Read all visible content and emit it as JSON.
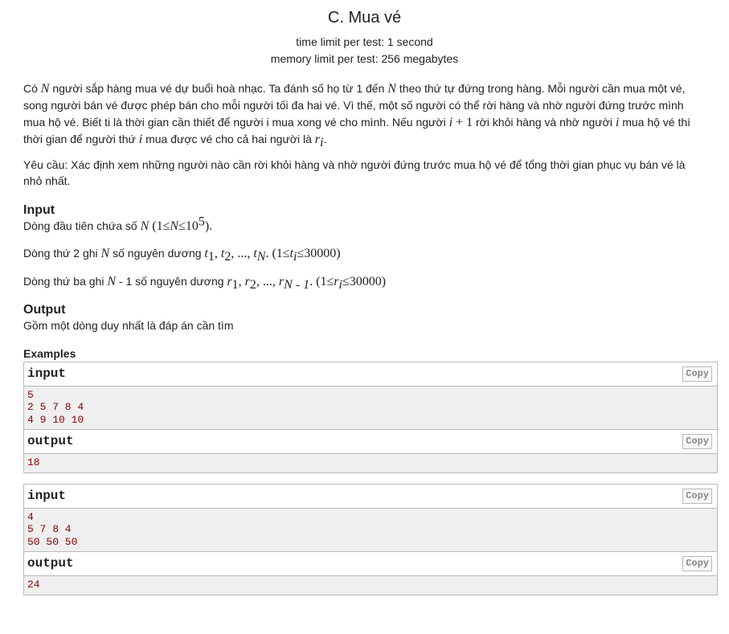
{
  "header": {
    "title": "C. Mua vé",
    "time_limit": "time limit per test: 1 second",
    "memory_limit": "memory limit per test: 256 megabytes"
  },
  "statement": {
    "p1": {
      "a": "Có ",
      "n": "N",
      "b": " người sắp hàng mua vé dự buổi hoà nhạc. Ta đánh số họ từ 1 đến ",
      "n2": "N",
      "c": " theo thứ tự đứng trong hàng. Mỗi người cần mua một vé, song người bán vé được phép bán cho mỗi người tối đa hai vé. Vì thế, một số người có thể rời hàng và nhờ người đứng trước mình mua hộ vé. Biết ti là thời gian cần thiết để người i mua xong vé cho mình. Nếu người ",
      "i1": "i",
      "plus": " + 1",
      "d": " rời khỏi hàng và nhờ người ",
      "i2": "i",
      "e": " mua hộ vé thì thời gian để người thứ ",
      "i3": "i",
      "f": " mua được vé cho cả hai người là ",
      "r": "r",
      "rsub": "i",
      "dot": "."
    },
    "p2": "Yêu cầu: Xác định xem những người nào cần rời khỏi hàng và nhờ người đứng trước mua hộ vé để tổng thời gian phục vụ bán vé là nhỏ nhất."
  },
  "input_section": {
    "title": "Input",
    "line1": {
      "a": "Dòng đầu tiên chứa số ",
      "n": "N",
      "open": " (1≤",
      "n2": "N",
      "le": "≤10",
      "exp": "5",
      "close": ")."
    },
    "line2": {
      "a": "Dòng thứ 2 ghi ",
      "n": "N",
      "b": " số nguyên dương ",
      "t": "t",
      "s1": "1",
      "c1": ", ",
      "t2": "t",
      "s2": "2",
      "c2": ", ..., ",
      "t3": "t",
      "sN": "N",
      "d": ". (1≤",
      "t4": "t",
      "si": "i",
      "e": "≤30000)"
    },
    "line3": {
      "a": "Dòng thứ ba ghi ",
      "n": "N",
      "b": " - 1 số nguyên dương ",
      "r": "r",
      "s1": "1",
      "c1": ", ",
      "r2": "r",
      "s2": "2",
      "c2": ", ..., ",
      "r3": "r",
      "sN": "N - 1",
      "d": ". (1≤",
      "r4": "r",
      "si": "i",
      "e": "≤30000)"
    }
  },
  "output_section": {
    "title": "Output",
    "text": "Gồm một dòng duy nhất là đáp án cần tìm"
  },
  "examples": {
    "title": "Examples",
    "input_label": "input",
    "output_label": "output",
    "copy_label": "Copy",
    "list": [
      {
        "input": [
          "5",
          "2 5 7 8 4",
          "4 9 10 10"
        ],
        "output": [
          "18"
        ]
      },
      {
        "input": [
          "4",
          "5 7 8 4",
          "50 50 50"
        ],
        "output": [
          "24"
        ]
      }
    ]
  }
}
